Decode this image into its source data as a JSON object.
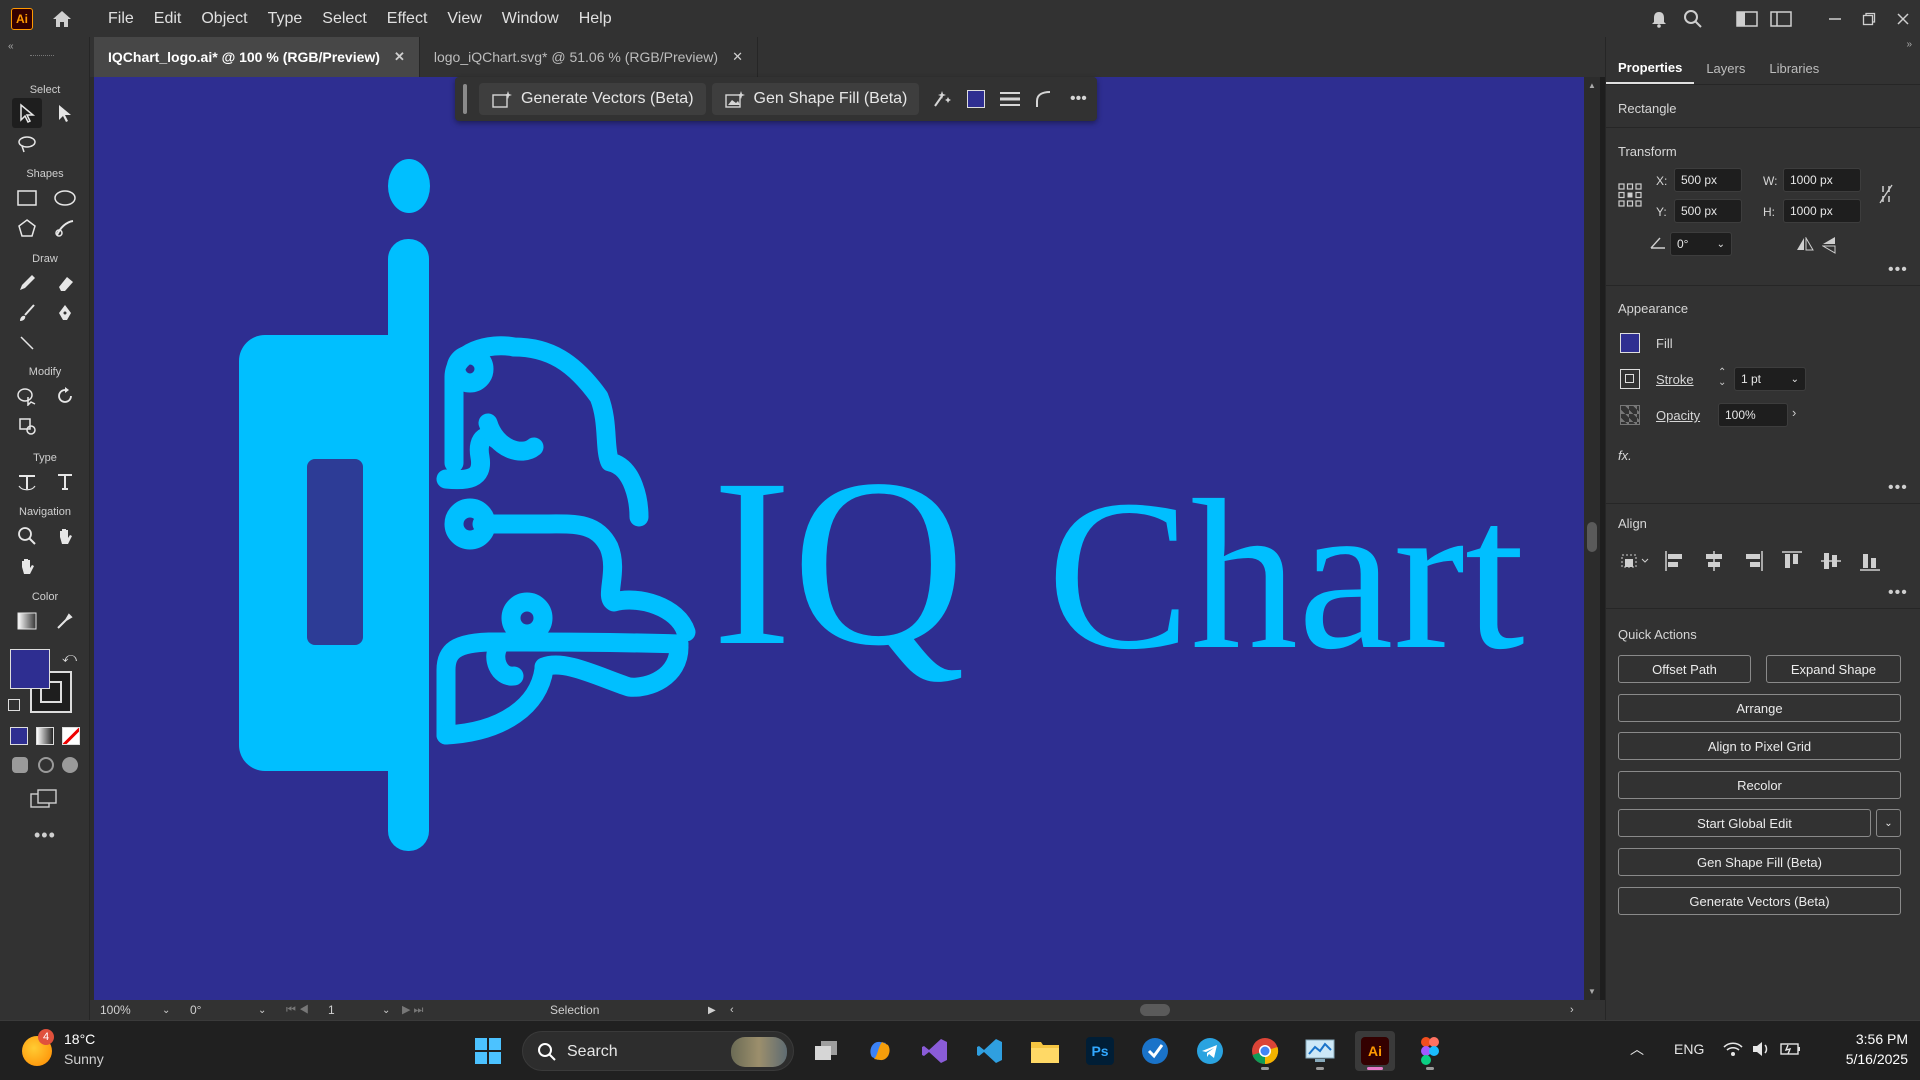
{
  "app": {
    "logo_text": "Ai",
    "menus": [
      "File",
      "Edit",
      "Object",
      "Type",
      "Select",
      "Effect",
      "View",
      "Window",
      "Help"
    ]
  },
  "tabs": [
    {
      "label": "IQChart_logo.ai* @ 100 % (RGB/Preview)",
      "close": "✕"
    },
    {
      "label": "logo_iQChart.svg* @ 51.06 % (RGB/Preview)",
      "close": "✕"
    }
  ],
  "toolbar": {
    "sections": [
      "Select",
      "Shapes",
      "Draw",
      "Modify",
      "Type",
      "Navigation",
      "Color"
    ]
  },
  "context_bar": {
    "generate_vectors": "Generate Vectors (Beta)",
    "gen_shape_fill": "Gen Shape Fill (Beta)"
  },
  "artwork": {
    "text_iq": "IQ",
    "text_chart": "Chart",
    "colors": {
      "background": "#2e2e91",
      "logo": "#00bfff",
      "inner_rect": "#2d3c96"
    }
  },
  "status": {
    "zoom": "100%",
    "rotation": "0°",
    "artboard": "1",
    "tool": "Selection"
  },
  "panel": {
    "tabs": [
      "Properties",
      "Layers",
      "Libraries"
    ],
    "object_type": "Rectangle",
    "transform": {
      "title": "Transform",
      "x_label": "X:",
      "x": "500 px",
      "y_label": "Y:",
      "y": "500 px",
      "w_label": "W:",
      "w": "1000 px",
      "h_label": "H:",
      "h": "1000 px",
      "angle": "0°"
    },
    "appearance": {
      "title": "Appearance",
      "fill": "Fill",
      "stroke": "Stroke",
      "stroke_weight": "1 pt",
      "opacity": "Opacity",
      "opacity_value": "100%",
      "fx": "fx."
    },
    "align": {
      "title": "Align"
    },
    "quick_actions": {
      "title": "Quick Actions",
      "offset_path": "Offset Path",
      "expand_shape": "Expand Shape",
      "arrange": "Arrange",
      "align_pixel": "Align to Pixel Grid",
      "recolor": "Recolor",
      "global_edit": "Start Global Edit",
      "gen_shape_fill": "Gen Shape Fill (Beta)",
      "generate_vectors": "Generate Vectors (Beta)"
    }
  },
  "windows": {
    "weather_temp": "18°C",
    "weather_desc": "Sunny",
    "weather_badge": "4",
    "search_label": "Search",
    "lang": "ENG",
    "time": "3:56 PM",
    "date": "5/16/2025"
  }
}
